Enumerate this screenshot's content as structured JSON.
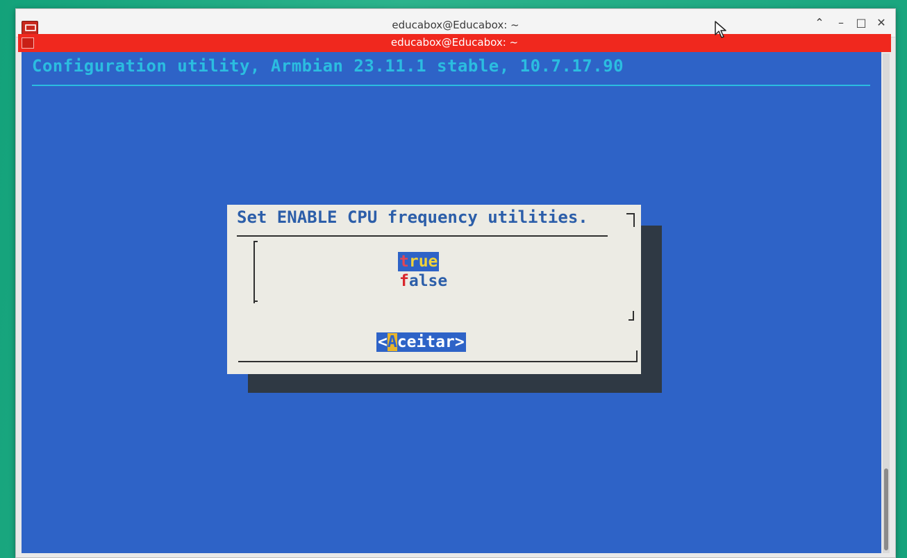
{
  "window": {
    "title": "educabox@Educabox: ~",
    "controls": {
      "shade": "⌃",
      "minimize": "–",
      "maximize": "□",
      "close": "✕"
    }
  },
  "tab": {
    "title": "educabox@Educabox: ~"
  },
  "terminal": {
    "backtitle": "Configuration utility, Armbian 23.11.1 stable, 10.7.17.90"
  },
  "dialog": {
    "title": "Set ENABLE CPU frequency utilities.",
    "options": [
      {
        "hotkey": "t",
        "rest": "rue",
        "selected": true
      },
      {
        "hotkey": "f",
        "rest": "alse",
        "selected": false
      }
    ],
    "button": {
      "open": "<",
      "hotkey": "A",
      "rest": "ceitar",
      "close": ">"
    }
  },
  "colors": {
    "terminal_bg": "#2e63c7",
    "dialog_bg": "#ecebe4",
    "tab_bar": "#f0281e",
    "backtitle": "#2bbde0",
    "highlight_text": "#f1d33a",
    "hotkey": "#d9262c"
  }
}
